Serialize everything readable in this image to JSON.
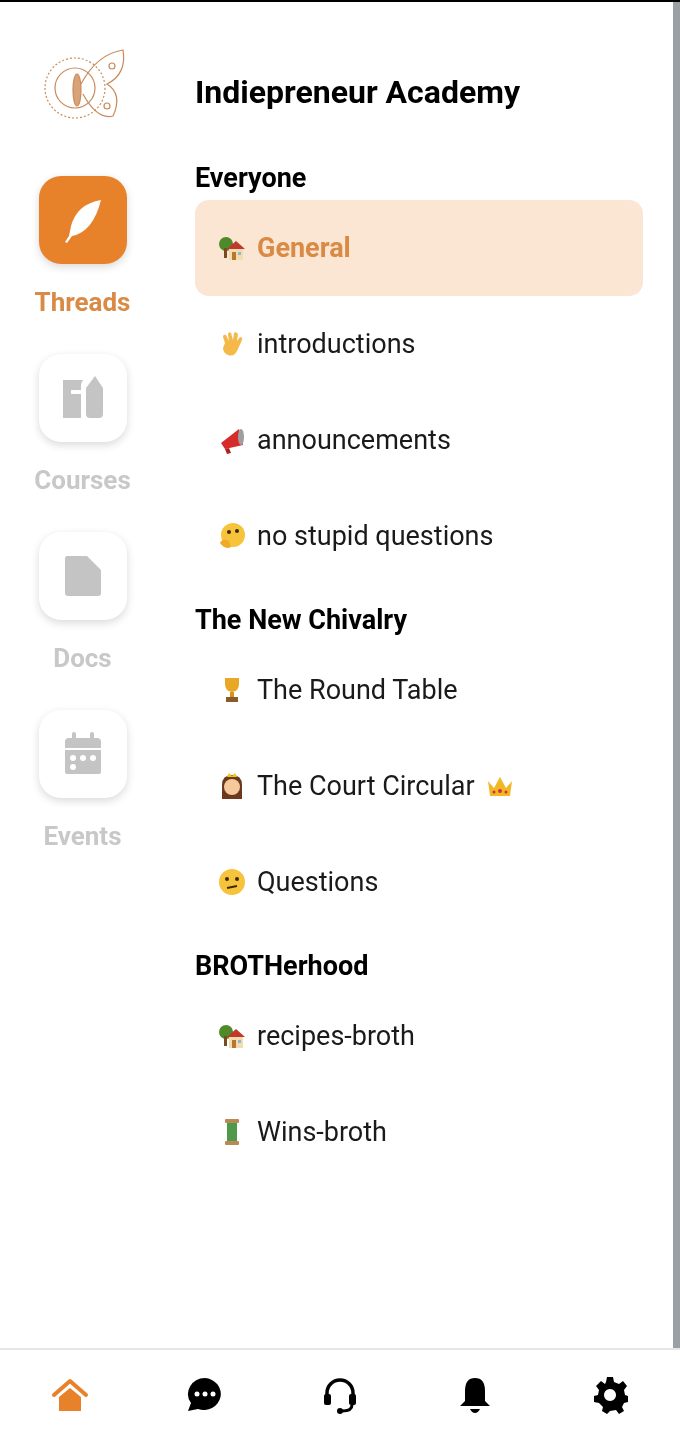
{
  "title": "Indiepreneur Academy",
  "rail": [
    {
      "label": "Threads",
      "kind": "feather",
      "selected": true
    },
    {
      "label": "Courses",
      "kind": "book",
      "selected": false
    },
    {
      "label": "Docs",
      "kind": "document",
      "selected": false
    },
    {
      "label": "Events",
      "kind": "calendar",
      "selected": false
    }
  ],
  "sections": [
    {
      "name": "Everyone",
      "channels": [
        {
          "name": "General",
          "kind": "house",
          "selected": true
        },
        {
          "name": "introductions",
          "kind": "hand",
          "selected": false
        },
        {
          "name": "announcements",
          "kind": "megaphone",
          "selected": false
        },
        {
          "name": "no stupid questions",
          "kind": "thinking",
          "selected": false
        }
      ]
    },
    {
      "name": "The New Chivalry",
      "channels": [
        {
          "name": "The Round Table",
          "kind": "trophy",
          "selected": false
        },
        {
          "name": "The Court Circular",
          "kind": "royal",
          "selected": false
        },
        {
          "name": "Questions",
          "kind": "confused",
          "selected": false
        }
      ]
    },
    {
      "name": "BROTHerhood",
      "channels": [
        {
          "name": "recipes-broth",
          "kind": "house",
          "selected": false
        },
        {
          "name": "Wins-broth",
          "kind": "spool",
          "selected": false
        }
      ]
    }
  ],
  "bottom_nav": [
    {
      "kind": "home",
      "selected": true
    },
    {
      "kind": "chat",
      "selected": false
    },
    {
      "kind": "headset",
      "selected": false
    },
    {
      "kind": "bell",
      "selected": false
    },
    {
      "kind": "gear",
      "selected": false
    }
  ]
}
